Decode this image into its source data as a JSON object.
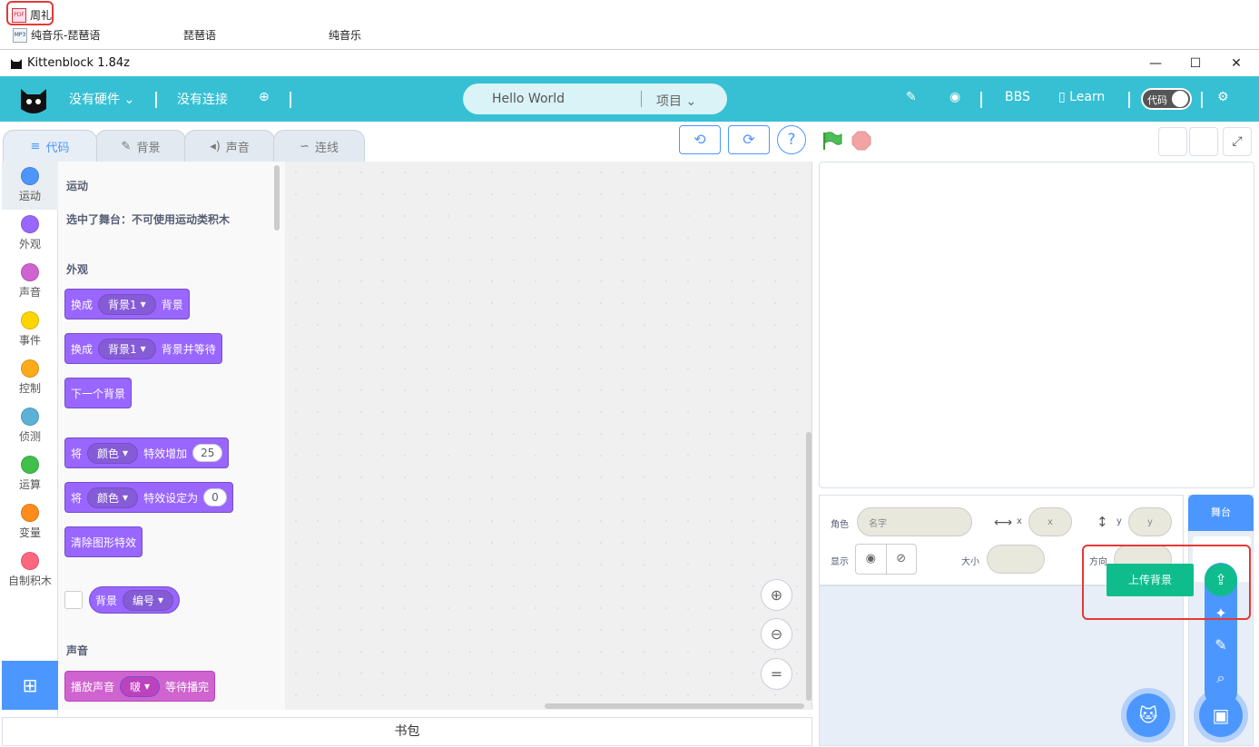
{
  "desktop": {
    "items": [
      {
        "label": "周礼"
      },
      {
        "label": "纯音乐-琵琶语"
      },
      {
        "label": "琵琶语"
      },
      {
        "label": "纯音乐"
      }
    ]
  },
  "window": {
    "title": "Kittenblock 1.84z",
    "minimize": "—",
    "maximize": "☐",
    "close": "✕"
  },
  "header": {
    "hardware": "没有硬件",
    "connection": "没有连接",
    "project_name": "Hello World",
    "project_menu": "项目",
    "bbs": "BBS",
    "learn": "Learn",
    "code_toggle": "代码"
  },
  "tabs": [
    {
      "label": "代码"
    },
    {
      "label": "背景"
    },
    {
      "label": "声音"
    },
    {
      "label": "连线"
    }
  ],
  "categories": [
    {
      "label": "运动",
      "color": "#4c97ff"
    },
    {
      "label": "外观",
      "color": "#9966ff"
    },
    {
      "label": "声音",
      "color": "#cf63cf"
    },
    {
      "label": "事件",
      "color": "#ffd500"
    },
    {
      "label": "控制",
      "color": "#ffab19"
    },
    {
      "label": "侦测",
      "color": "#5cb1d6"
    },
    {
      "label": "运算",
      "color": "#40bf4a"
    },
    {
      "label": "变量",
      "color": "#ff8c1a"
    },
    {
      "label": "自制积木",
      "color": "#ff6680"
    }
  ],
  "palette": {
    "motion_head": "运动",
    "motion_note": "选中了舞台：不可使用运动类积木",
    "looks_head": "外观",
    "sound_head": "声音",
    "blocks": {
      "b1": {
        "pre": "换成",
        "dd": "背景1",
        "post": "背景"
      },
      "b2": {
        "pre": "换成",
        "dd": "背景1",
        "post": "背景并等待"
      },
      "b3": {
        "pre": "下一个背景"
      },
      "b4": {
        "pre": "将",
        "dd": "颜色",
        "post": "特效增加",
        "num": "25"
      },
      "b5": {
        "pre": "将",
        "dd": "颜色",
        "post": "特效设定为",
        "num": "0"
      },
      "b6": {
        "pre": "清除图形特效"
      },
      "b7": {
        "pre": "背景",
        "dd": "编号"
      },
      "b8": {
        "pre": "播放声音",
        "dd": "啵",
        "post": "等待播完"
      }
    }
  },
  "backpack": "书包",
  "sprite_info": {
    "sprite_label": "角色",
    "name_placeholder": "名字",
    "x_label": "x",
    "x_placeholder": "x",
    "y_label": "y",
    "y_placeholder": "y",
    "show_label": "显示",
    "size_label": "大小",
    "direction_label": "方向"
  },
  "stage_panel": {
    "title": "舞台",
    "upload_tooltip": "上传背景"
  }
}
